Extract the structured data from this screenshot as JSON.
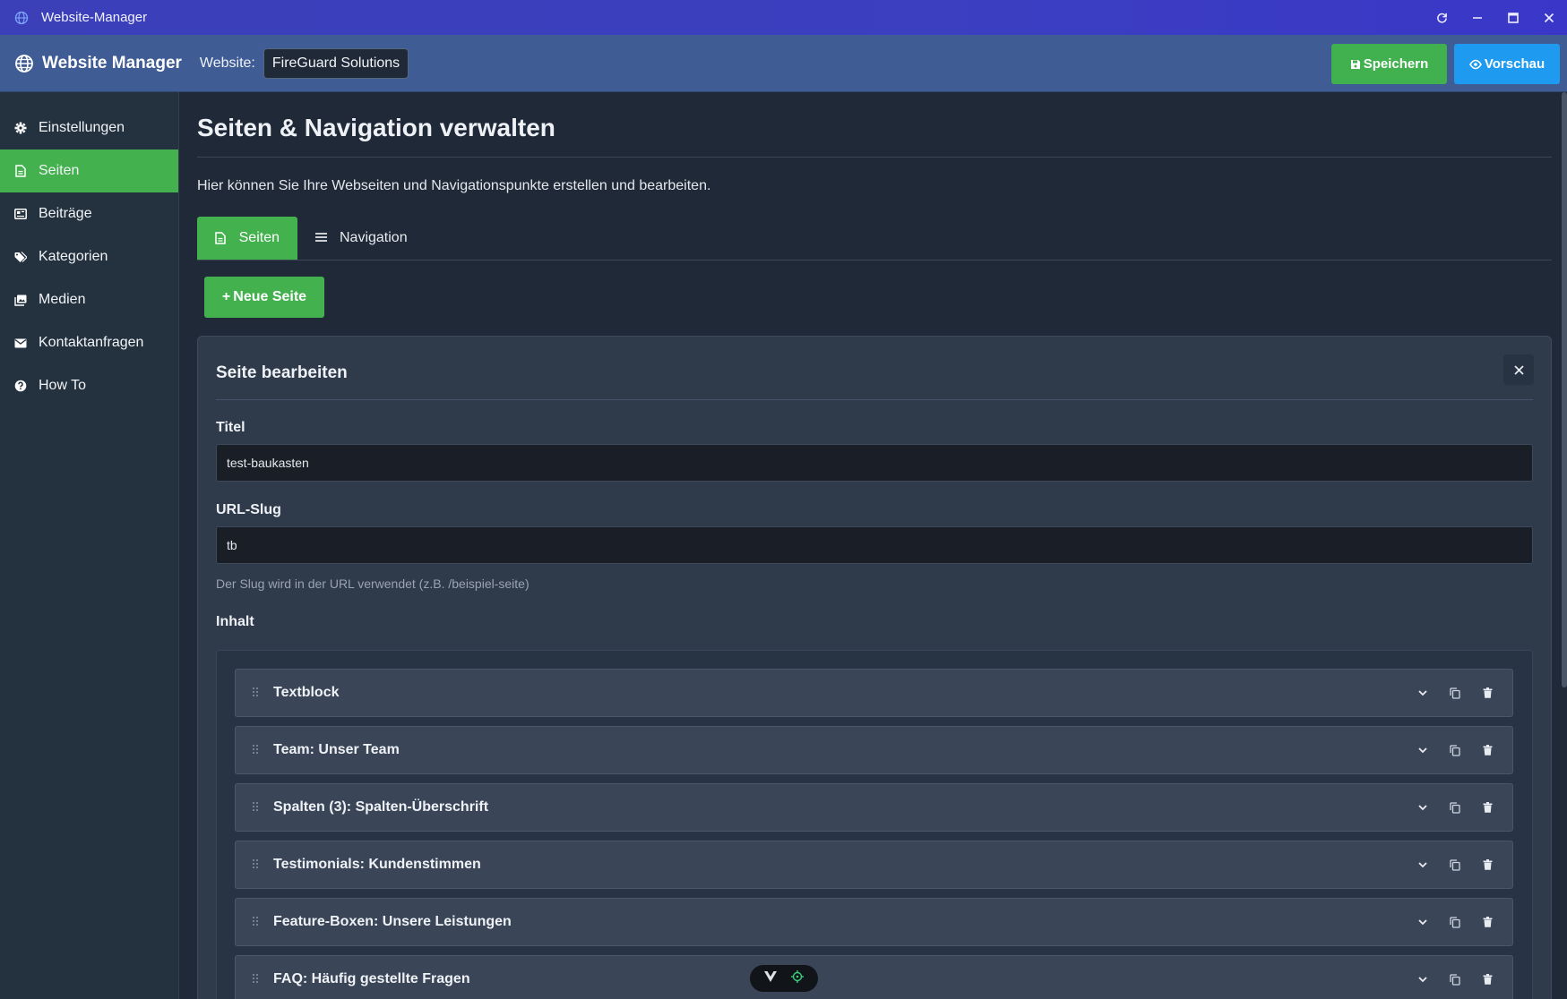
{
  "window": {
    "title": "Website-Manager"
  },
  "header": {
    "brand": "Website Manager",
    "website_label": "Website:",
    "website_value": "FireGuard Solutions",
    "save_label": "Speichern",
    "preview_label": "Vorschau"
  },
  "sidebar": {
    "items": [
      {
        "label": "Einstellungen",
        "icon": "gear-icon"
      },
      {
        "label": "Seiten",
        "icon": "file-icon",
        "active": true
      },
      {
        "label": "Beiträge",
        "icon": "newspaper-icon"
      },
      {
        "label": "Kategorien",
        "icon": "tags-icon"
      },
      {
        "label": "Medien",
        "icon": "images-icon"
      },
      {
        "label": "Kontaktanfragen",
        "icon": "envelope-icon"
      },
      {
        "label": "How To",
        "icon": "question-circle-icon"
      }
    ]
  },
  "main": {
    "title": "Seiten & Navigation verwalten",
    "intro": "Hier können Sie Ihre Webseiten und Navigationspunkte erstellen und bearbeiten.",
    "tabs": [
      {
        "label": "Seiten",
        "icon": "file-icon",
        "active": true
      },
      {
        "label": "Navigation",
        "icon": "bars-icon"
      }
    ],
    "new_page_label": "Neue Seite"
  },
  "editor": {
    "title": "Seite bearbeiten",
    "title_label": "Titel",
    "title_value": "test-baukasten",
    "slug_label": "URL-Slug",
    "slug_value": "tb",
    "slug_hint": "Der Slug wird in der URL verwendet (z.B. /beispiel-seite)",
    "content_label": "Inhalt",
    "blocks": [
      "Textblock",
      "Team: Unser Team",
      "Spalten (3): Spalten-Überschrift",
      "Testimonials: Kundenstimmen",
      "Feature-Boxen: Unsere Leistungen",
      "FAQ: Häufig gestellte Fragen"
    ]
  },
  "colors": {
    "accent_green": "#44b14f",
    "accent_blue": "#1e9bf0",
    "header_blue": "#3f5d94",
    "titlebar": "#3b3fc0"
  }
}
